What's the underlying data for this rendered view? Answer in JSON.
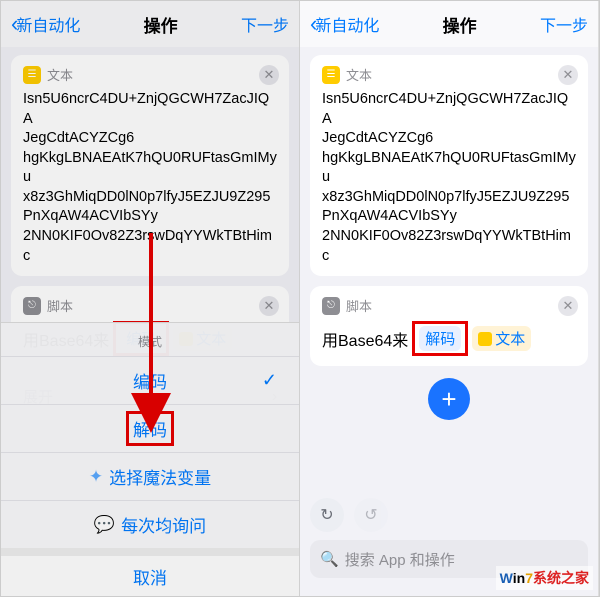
{
  "nav": {
    "back": "新自动化",
    "title": "操作",
    "next": "下一步"
  },
  "textCard": {
    "label": "文本",
    "body": "Isn5U6ncrC4DU+ZnjQGCWH7ZacJIQA\nJegCdtACYZCg6\nhgKkgLBNAEAtK7hQU0RUFtasGmIMyu\nx8z3GhMiqDD0lN0p7lfyJ5EZJU9Z295\nPnXqAW4ACVIbSYy\n2NN0KIF0Ov82Z3rswDqYYWkTBtHimc"
  },
  "scriptCard": {
    "label": "脚本",
    "prefix": "用Base64来",
    "encodeWord": "编码",
    "decodeWord": "解码",
    "tail": "文本"
  },
  "expand": "展开",
  "sheet": {
    "title": "模式",
    "opt1": "编码",
    "opt2": "解码",
    "magic": "选择魔法变量",
    "ask": "每次均询问",
    "cancel": "取消"
  },
  "search": {
    "placeholder": "搜索 App 和操作"
  },
  "watermark": "Win7系统之家"
}
